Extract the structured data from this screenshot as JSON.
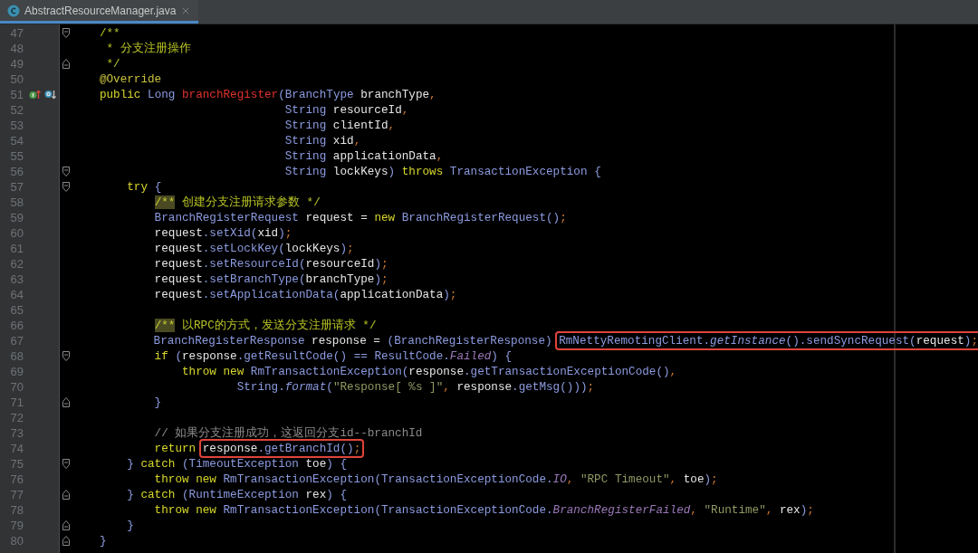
{
  "tab": {
    "title": "AbstractResourceManager.java",
    "selected": true
  },
  "lines": [
    {
      "number": "47",
      "fold_start": true,
      "tokens": [
        {
          "text": "    /**",
          "kind": "doc"
        }
      ]
    },
    {
      "number": "48",
      "tokens": [
        {
          "text": "     * 分支注册操作",
          "kind": "doc"
        }
      ]
    },
    {
      "number": "49",
      "fold_end": true,
      "tokens": [
        {
          "text": "     */",
          "kind": "doc"
        }
      ]
    },
    {
      "number": "50",
      "tokens": [
        {
          "text": "    @Override",
          "kind": "annotation"
        }
      ]
    },
    {
      "number": "51",
      "marks": true,
      "tokens": [
        {
          "text": "    public ",
          "kind": "keyword"
        },
        {
          "text": "Long ",
          "kind": "type"
        },
        {
          "text": "branchRegister",
          "kind": "decl"
        },
        {
          "text": "(",
          "kind": "punct"
        },
        {
          "text": "BranchType ",
          "kind": "type"
        },
        {
          "text": "branchType",
          "kind": "ident"
        },
        {
          "text": ",",
          "kind": "sep"
        }
      ]
    },
    {
      "number": "52",
      "tokens": [
        {
          "text": "                               String ",
          "kind": "type"
        },
        {
          "text": "resourceId",
          "kind": "ident"
        },
        {
          "text": ",",
          "kind": "sep"
        }
      ]
    },
    {
      "number": "53",
      "tokens": [
        {
          "text": "                               String ",
          "kind": "type"
        },
        {
          "text": "clientId",
          "kind": "ident"
        },
        {
          "text": ",",
          "kind": "sep"
        }
      ]
    },
    {
      "number": "54",
      "tokens": [
        {
          "text": "                               String ",
          "kind": "type"
        },
        {
          "text": "xid",
          "kind": "ident"
        },
        {
          "text": ",",
          "kind": "sep"
        }
      ]
    },
    {
      "number": "55",
      "tokens": [
        {
          "text": "                               String ",
          "kind": "type"
        },
        {
          "text": "applicationData",
          "kind": "ident"
        },
        {
          "text": ",",
          "kind": "sep"
        }
      ]
    },
    {
      "number": "56",
      "fold_start": true,
      "tokens": [
        {
          "text": "                               String ",
          "kind": "type"
        },
        {
          "text": "lockKeys",
          "kind": "ident"
        },
        {
          "text": ") ",
          "kind": "punct"
        },
        {
          "text": "throws ",
          "kind": "keyword"
        },
        {
          "text": "TransactionException ",
          "kind": "type"
        },
        {
          "text": "{",
          "kind": "punct"
        }
      ]
    },
    {
      "number": "57",
      "fold_start": true,
      "tokens": [
        {
          "text": "        try ",
          "kind": "keyword"
        },
        {
          "text": "{",
          "kind": "punct"
        }
      ]
    },
    {
      "number": "58",
      "tokens": [
        {
          "text": "            /**",
          "kind": "docmark"
        },
        {
          "text": " 创建分支注册请求参数 */",
          "kind": "doc"
        }
      ]
    },
    {
      "number": "59",
      "tokens": [
        {
          "text": "            BranchRegisterRequest ",
          "kind": "type"
        },
        {
          "text": "request = ",
          "kind": "ident"
        },
        {
          "text": "new ",
          "kind": "keyword"
        },
        {
          "text": "BranchRegisterRequest",
          "kind": "type"
        },
        {
          "text": "()",
          "kind": "punct"
        },
        {
          "text": ";",
          "kind": "sep"
        }
      ]
    },
    {
      "number": "60",
      "tokens": [
        {
          "text": "            request",
          "kind": "ident"
        },
        {
          "text": ".setXid(",
          "kind": "punct"
        },
        {
          "text": "xid",
          "kind": "ident"
        },
        {
          "text": ")",
          "kind": "punct"
        },
        {
          "text": ";",
          "kind": "sep"
        }
      ]
    },
    {
      "number": "61",
      "tokens": [
        {
          "text": "            request",
          "kind": "ident"
        },
        {
          "text": ".setLockKey(",
          "kind": "punct"
        },
        {
          "text": "lockKeys",
          "kind": "ident"
        },
        {
          "text": ")",
          "kind": "punct"
        },
        {
          "text": ";",
          "kind": "sep"
        }
      ]
    },
    {
      "number": "62",
      "tokens": [
        {
          "text": "            request",
          "kind": "ident"
        },
        {
          "text": ".setResourceId(",
          "kind": "punct"
        },
        {
          "text": "resourceId",
          "kind": "ident"
        },
        {
          "text": ")",
          "kind": "punct"
        },
        {
          "text": ";",
          "kind": "sep"
        }
      ]
    },
    {
      "number": "63",
      "tokens": [
        {
          "text": "            request",
          "kind": "ident"
        },
        {
          "text": ".setBranchType(",
          "kind": "punct"
        },
        {
          "text": "branchType",
          "kind": "ident"
        },
        {
          "text": ")",
          "kind": "punct"
        },
        {
          "text": ";",
          "kind": "sep"
        }
      ]
    },
    {
      "number": "64",
      "tokens": [
        {
          "text": "            request",
          "kind": "ident"
        },
        {
          "text": ".setApplicationData(",
          "kind": "punct"
        },
        {
          "text": "applicationData",
          "kind": "ident"
        },
        {
          "text": ")",
          "kind": "punct"
        },
        {
          "text": ";",
          "kind": "sep"
        }
      ]
    },
    {
      "number": "65"
    },
    {
      "number": "66",
      "tokens": [
        {
          "text": "            /**",
          "kind": "docmark"
        },
        {
          "text": " 以RPC的方式，发送分支注册请求 */",
          "kind": "doc"
        }
      ]
    },
    {
      "number": "67",
      "segments": [
        {
          "boxed": false,
          "tokens": [
            {
              "text": "            BranchRegisterResponse ",
              "kind": "type"
            },
            {
              "text": "response = ",
              "kind": "ident"
            },
            {
              "text": "(",
              "kind": "punct"
            },
            {
              "text": "BranchRegisterResponse",
              "kind": "type"
            },
            {
              "text": ") ",
              "kind": "punct"
            }
          ]
        },
        {
          "boxed": true,
          "tokens": [
            {
              "text": "RmNettyRemotingClient",
              "kind": "type"
            },
            {
              "text": ".",
              "kind": "punct"
            },
            {
              "text": "getInstance",
              "kind": "static_method"
            },
            {
              "text": "().sendSyncRequest(",
              "kind": "punct"
            },
            {
              "text": "request",
              "kind": "ident"
            },
            {
              "text": ")",
              "kind": "punct"
            },
            {
              "text": ";",
              "kind": "sep"
            }
          ]
        }
      ]
    },
    {
      "number": "68",
      "fold_start": true,
      "tokens": [
        {
          "text": "            if ",
          "kind": "keyword"
        },
        {
          "text": "(",
          "kind": "punct"
        },
        {
          "text": "response",
          "kind": "ident"
        },
        {
          "text": ".getResultCode() == ",
          "kind": "punct"
        },
        {
          "text": "ResultCode",
          "kind": "type"
        },
        {
          "text": ".",
          "kind": "punct"
        },
        {
          "text": "Failed",
          "kind": "static_field"
        },
        {
          "text": ") {",
          "kind": "punct"
        }
      ]
    },
    {
      "number": "69",
      "tokens": [
        {
          "text": "                throw new ",
          "kind": "keyword"
        },
        {
          "text": "RmTransactionException",
          "kind": "type"
        },
        {
          "text": "(",
          "kind": "punct"
        },
        {
          "text": "response",
          "kind": "ident"
        },
        {
          "text": ".getTransactionExceptionCode()",
          "kind": "punct"
        },
        {
          "text": ",",
          "kind": "sep"
        }
      ]
    },
    {
      "number": "70",
      "tokens": [
        {
          "text": "                        String",
          "kind": "type"
        },
        {
          "text": ".",
          "kind": "punct"
        },
        {
          "text": "format",
          "kind": "static_method"
        },
        {
          "text": "(",
          "kind": "punct"
        },
        {
          "text": "\"Response[ %s ]\"",
          "kind": "string"
        },
        {
          "text": ", ",
          "kind": "sep"
        },
        {
          "text": "response",
          "kind": "ident"
        },
        {
          "text": ".getMsg()))",
          "kind": "punct"
        },
        {
          "text": ";",
          "kind": "sep"
        }
      ]
    },
    {
      "number": "71",
      "fold_end": true,
      "tokens": [
        {
          "text": "            }",
          "kind": "punct"
        }
      ]
    },
    {
      "number": "72"
    },
    {
      "number": "73",
      "tokens": [
        {
          "text": "            // 如果分支注册成功，这返回分支id--branchId",
          "kind": "comment"
        }
      ]
    },
    {
      "number": "74",
      "segments": [
        {
          "boxed": false,
          "tokens": [
            {
              "text": "            return ",
              "kind": "keyword"
            }
          ]
        },
        {
          "boxed": true,
          "tokens": [
            {
              "text": "response",
              "kind": "ident"
            },
            {
              "text": ".getBranchId()",
              "kind": "punct"
            },
            {
              "text": ";",
              "kind": "sep"
            }
          ]
        }
      ]
    },
    {
      "number": "75",
      "fold_start": true,
      "tokens": [
        {
          "text": "        } ",
          "kind": "punct"
        },
        {
          "text": "catch ",
          "kind": "keyword"
        },
        {
          "text": "(",
          "kind": "punct"
        },
        {
          "text": "TimeoutException ",
          "kind": "type"
        },
        {
          "text": "toe",
          "kind": "ident"
        },
        {
          "text": ") {",
          "kind": "punct"
        }
      ]
    },
    {
      "number": "76",
      "tokens": [
        {
          "text": "            throw new ",
          "kind": "keyword"
        },
        {
          "text": "RmTransactionException",
          "kind": "type"
        },
        {
          "text": "(TransactionExceptionCode.",
          "kind": "punct"
        },
        {
          "text": "IO",
          "kind": "static_field"
        },
        {
          "text": ", ",
          "kind": "sep"
        },
        {
          "text": "\"RPC Timeout\"",
          "kind": "string"
        },
        {
          "text": ", ",
          "kind": "sep"
        },
        {
          "text": "toe",
          "kind": "ident"
        },
        {
          "text": ")",
          "kind": "punct"
        },
        {
          "text": ";",
          "kind": "sep"
        }
      ]
    },
    {
      "number": "77",
      "fold_end": true,
      "tokens": [
        {
          "text": "        } ",
          "kind": "punct"
        },
        {
          "text": "catch ",
          "kind": "keyword"
        },
        {
          "text": "(",
          "kind": "punct"
        },
        {
          "text": "RuntimeException ",
          "kind": "type"
        },
        {
          "text": "rex",
          "kind": "ident"
        },
        {
          "text": ") {",
          "kind": "punct"
        }
      ]
    },
    {
      "number": "78",
      "tokens": [
        {
          "text": "            throw new ",
          "kind": "keyword"
        },
        {
          "text": "RmTransactionException",
          "kind": "type"
        },
        {
          "text": "(TransactionExceptionCode.",
          "kind": "punct"
        },
        {
          "text": "BranchRegisterFailed",
          "kind": "static_field"
        },
        {
          "text": ", ",
          "kind": "sep"
        },
        {
          "text": "\"Runtime\"",
          "kind": "string"
        },
        {
          "text": ", ",
          "kind": "sep"
        },
        {
          "text": "rex",
          "kind": "ident"
        },
        {
          "text": ")",
          "kind": "punct"
        },
        {
          "text": ";",
          "kind": "sep"
        }
      ]
    },
    {
      "number": "79",
      "fold_end": true,
      "tokens": [
        {
          "text": "        }",
          "kind": "punct"
        }
      ]
    },
    {
      "number": "80",
      "fold_end": true,
      "tokens": [
        {
          "text": "    }",
          "kind": "punct"
        }
      ]
    }
  ]
}
